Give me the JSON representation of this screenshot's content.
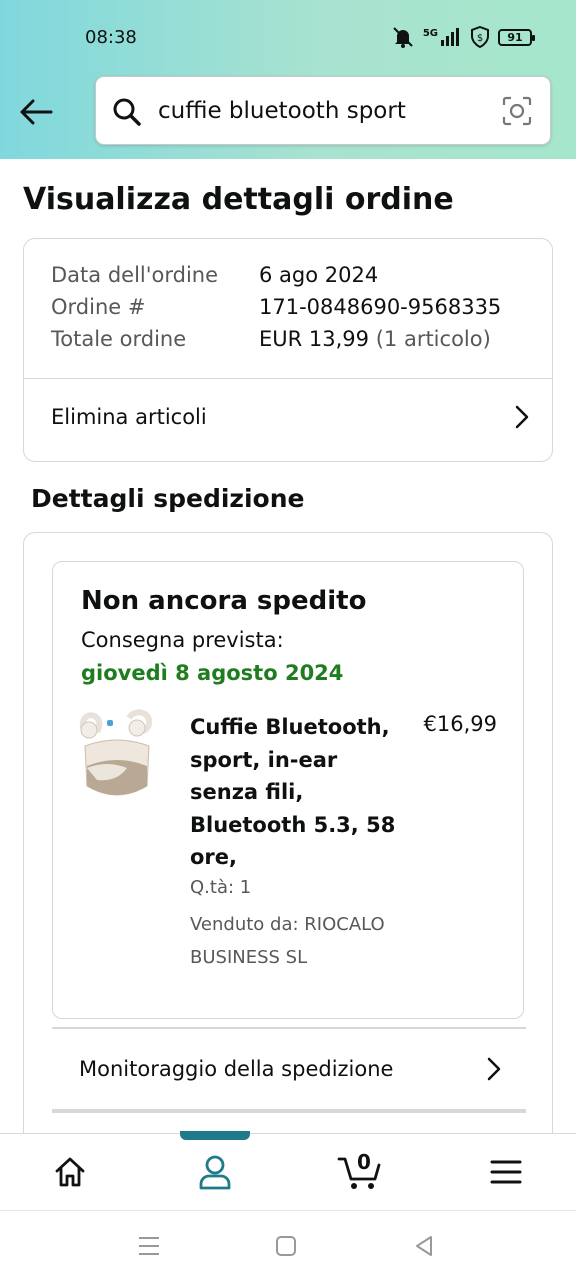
{
  "status_bar": {
    "time": "08:38",
    "network": "5G",
    "battery": "91"
  },
  "search": {
    "query": "cuffie bluetooth sport"
  },
  "page": {
    "title": "Visualizza dettagli ordine"
  },
  "order_summary": {
    "rows": [
      {
        "label": "Data dell'ordine",
        "value": "6 ago 2024"
      },
      {
        "label": "Ordine #",
        "value": "171-0848690-9568335"
      },
      {
        "label": "Totale ordine",
        "value": "EUR 13,99",
        "note": "(1 articolo)"
      }
    ],
    "delete_link": "Elimina articoli"
  },
  "shipment": {
    "section_title": "Dettagli spedizione",
    "status": "Non ancora spedito",
    "delivery_label": "Consegna prevista:",
    "delivery_date": "giovedì 8 agosto 2024",
    "product": {
      "name": "Cuffie Bluetooth, sport, in-ear senza fili, Bluetooth 5.3, 58 ore,",
      "price": "€16,99",
      "qty": "Q.tà: 1",
      "seller": "Venduto da: RIOCALO BUSINESS SL"
    },
    "tracking_link": "Monitoraggio della spedizione"
  },
  "bottom_nav": {
    "items": [
      "home-icon",
      "account-icon",
      "cart-icon",
      "menu-icon"
    ],
    "active": "account-icon",
    "cart_count": "0"
  },
  "colors": {
    "accent": "#1f7a8a",
    "delivery_green": "#1f7d1f",
    "header_start": "#80d8dd",
    "header_end": "#a6e7cb"
  }
}
